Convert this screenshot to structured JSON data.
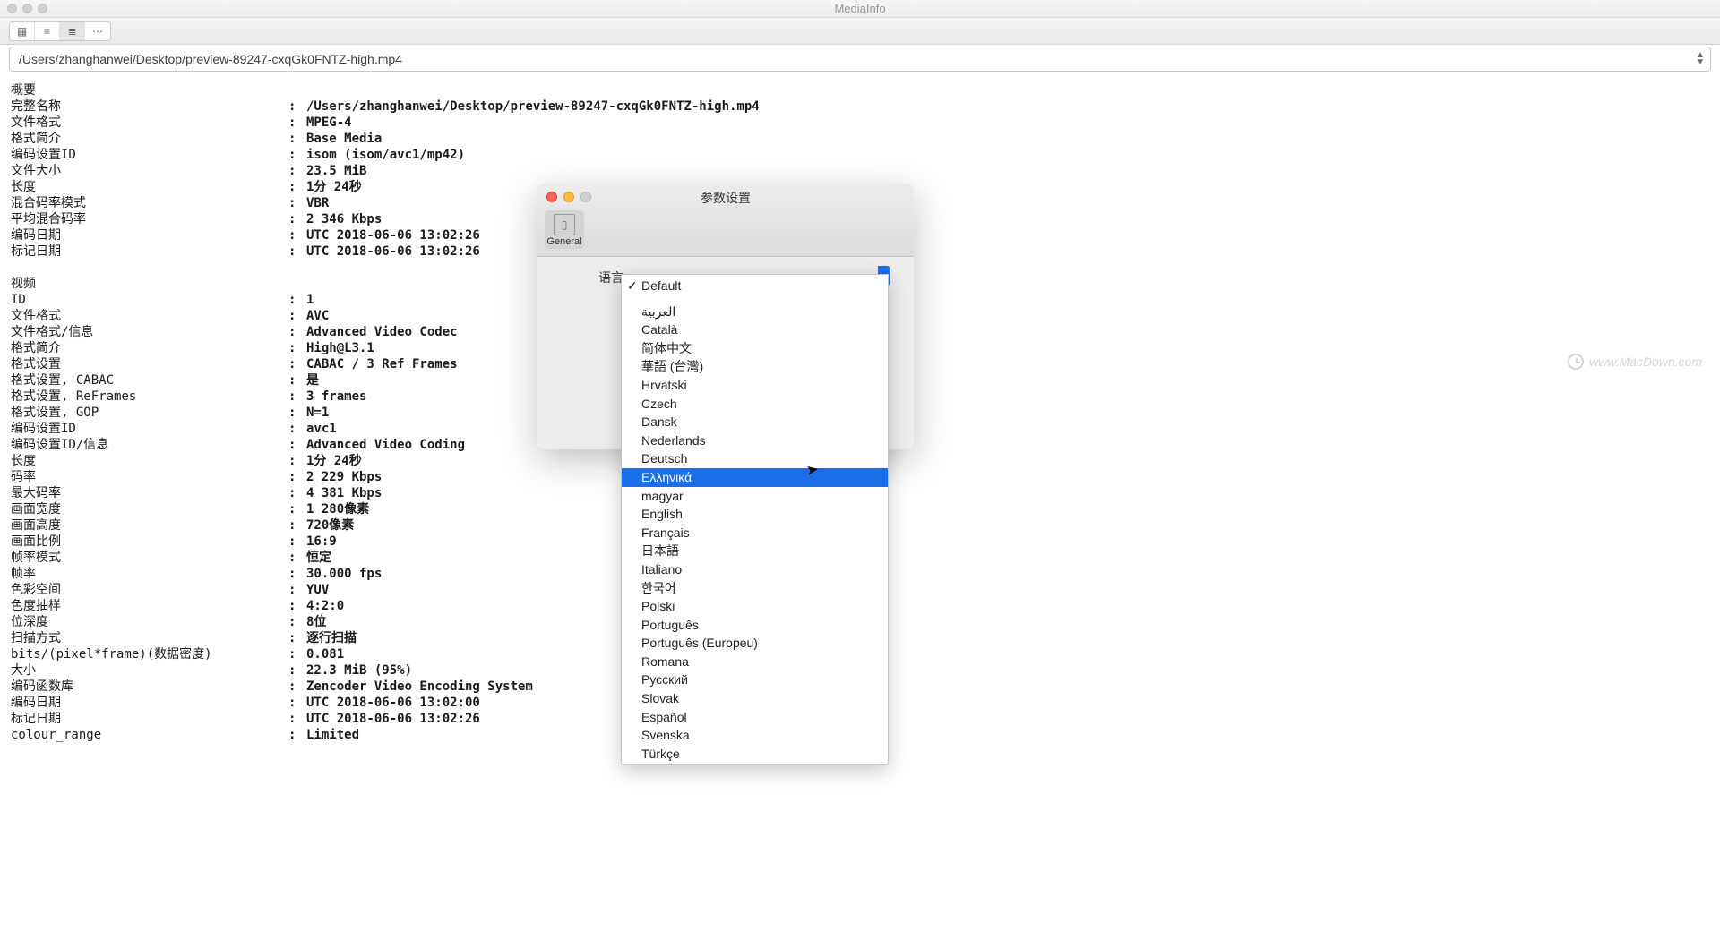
{
  "window_title": "MediaInfo",
  "path": "/Users/zhanghanwei/Desktop/preview-89247-cxqGk0FNTZ-high.mp4",
  "sections": [
    {
      "title": "概要",
      "rows": [
        {
          "k": "完整名称",
          "v": "/Users/zhanghanwei/Desktop/preview-89247-cxqGk0FNTZ-high.mp4"
        },
        {
          "k": "文件格式",
          "v": "MPEG-4"
        },
        {
          "k": "格式简介",
          "v": "Base Media"
        },
        {
          "k": "编码设置ID",
          "v": "isom (isom/avc1/mp42)"
        },
        {
          "k": "文件大小",
          "v": "23.5 MiB"
        },
        {
          "k": "长度",
          "v": "1分 24秒"
        },
        {
          "k": "混合码率模式",
          "v": "VBR"
        },
        {
          "k": "平均混合码率",
          "v": "2 346 Kbps"
        },
        {
          "k": "编码日期",
          "v": "UTC 2018-06-06 13:02:26"
        },
        {
          "k": "标记日期",
          "v": "UTC 2018-06-06 13:02:26"
        }
      ]
    },
    {
      "title": "视频",
      "rows": [
        {
          "k": "ID",
          "v": "1"
        },
        {
          "k": "文件格式",
          "v": "AVC"
        },
        {
          "k": "文件格式/信息",
          "v": "Advanced Video Codec"
        },
        {
          "k": "格式简介",
          "v": "High@L3.1"
        },
        {
          "k": "格式设置",
          "v": "CABAC / 3 Ref Frames"
        },
        {
          "k": "格式设置, CABAC",
          "v": "是"
        },
        {
          "k": "格式设置, ReFrames",
          "v": "3 frames"
        },
        {
          "k": "格式设置, GOP",
          "v": "N=1"
        },
        {
          "k": "编码设置ID",
          "v": "avc1"
        },
        {
          "k": "编码设置ID/信息",
          "v": "Advanced Video Coding"
        },
        {
          "k": "长度",
          "v": "1分 24秒"
        },
        {
          "k": "码率",
          "v": "2 229 Kbps"
        },
        {
          "k": "最大码率",
          "v": "4 381 Kbps"
        },
        {
          "k": "画面宽度",
          "v": "1 280像素"
        },
        {
          "k": "画面高度",
          "v": "720像素"
        },
        {
          "k": "画面比例",
          "v": "16:9"
        },
        {
          "k": "帧率模式",
          "v": "恒定"
        },
        {
          "k": "帧率",
          "v": "30.000 fps"
        },
        {
          "k": "色彩空间",
          "v": "YUV"
        },
        {
          "k": "色度抽样",
          "v": "4:2:0"
        },
        {
          "k": "位深度",
          "v": "8位"
        },
        {
          "k": "扫描方式",
          "v": "逐行扫描"
        },
        {
          "k": "bits/(pixel*frame)(数据密度)",
          "v": "0.081"
        },
        {
          "k": "大小",
          "v": "22.3 MiB (95%)"
        },
        {
          "k": "编码函数库",
          "v": "Zencoder Video Encoding System"
        },
        {
          "k": "编码日期",
          "v": "UTC 2018-06-06 13:02:00"
        },
        {
          "k": "标记日期",
          "v": "UTC 2018-06-06 13:02:26"
        },
        {
          "k": "colour_range",
          "v": "Limited"
        }
      ]
    }
  ],
  "prefs": {
    "title": "参数设置",
    "tab_label": "General",
    "lang_label": "语言"
  },
  "languages": [
    "Default",
    "",
    "العربية",
    "Català",
    "简体中文",
    "華語 (台灣)",
    "Hrvatski",
    "Czech",
    "Dansk",
    "Nederlands",
    "Deutsch",
    "Ελληνικά",
    "magyar",
    "English",
    "Français",
    "日本語",
    "Italiano",
    "한국어",
    "Polski",
    "Português",
    "Português (Europeu)",
    "Romana",
    "Русский",
    "Slovak",
    "Español",
    "Svenska",
    "Türkçe"
  ],
  "lang_checked_index": 0,
  "lang_selected_index": 11,
  "watermark": "www.MacDown.com"
}
